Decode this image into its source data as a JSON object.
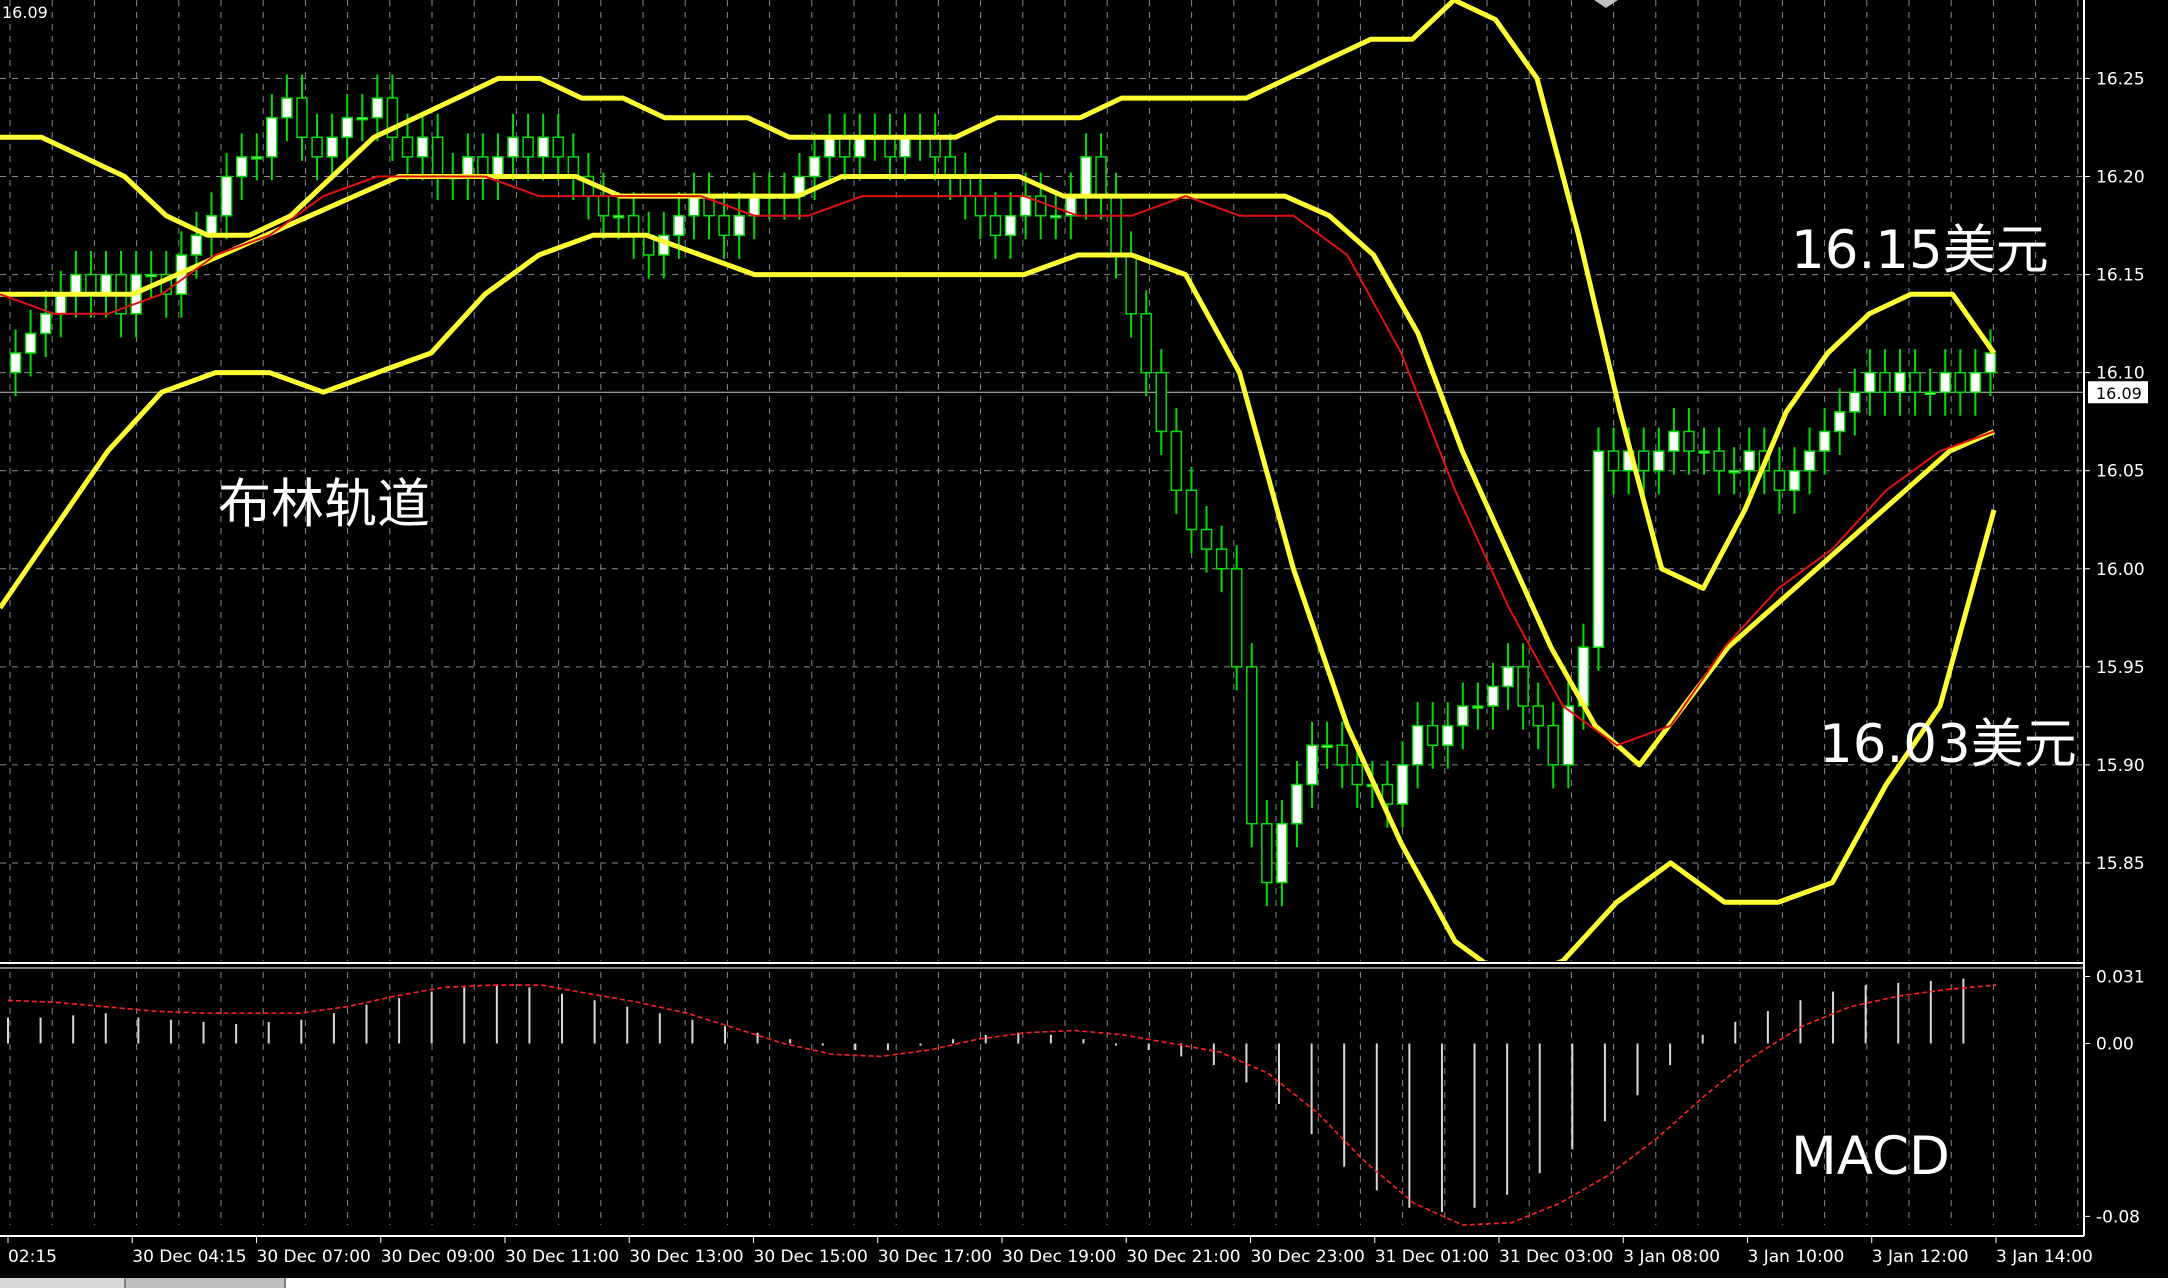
{
  "window": {
    "corner_price": "16.09",
    "colors": {
      "background": "#000000",
      "grid": "#8a8a8a",
      "candle_bull": "#ffffff",
      "candle_bear": "#000000",
      "candle_wick": "#00dd00",
      "bollinger": "#ffff33",
      "ma": "#e01010",
      "macd_hist": "#d8d8d8",
      "macd_signal": "#ff2020",
      "axis_text": "#ffffff"
    }
  },
  "annotations": {
    "bollinger_label": "布林轨道",
    "upper_target": "16.15美元",
    "lower_target": "16.03美元",
    "macd_label": "MACD"
  },
  "chart_data": [
    {
      "type": "candlestick",
      "title": "",
      "ylim": [
        15.8,
        16.29
      ],
      "y_ticks": [
        "16.25",
        "16.20",
        "16.15",
        "16.10",
        "16.05",
        "16.00",
        "15.95",
        "15.90",
        "15.85"
      ],
      "current_price": "16.09",
      "grid": true,
      "x_labels": [
        "02:15",
        "30 Dec 04:15",
        "30 Dec 07:00",
        "30 Dec 09:00",
        "30 Dec 11:00",
        "30 Dec 13:00",
        "30 Dec 15:00",
        "30 Dec 17:00",
        "30 Dec 19:00",
        "30 Dec 21:00",
        "30 Dec 23:00",
        "31 Dec 01:00",
        "31 Dec 03:00",
        "3 Jan 08:00",
        "3 Jan 10:00",
        "3 Jan 12:00",
        "3 Jan 14:00"
      ],
      "close": [
        16.11,
        16.12,
        16.13,
        16.14,
        16.15,
        16.14,
        16.15,
        16.13,
        16.15,
        16.15,
        16.14,
        16.16,
        16.17,
        16.18,
        16.2,
        16.21,
        16.21,
        16.23,
        16.24,
        16.22,
        16.21,
        16.22,
        16.23,
        16.23,
        16.24,
        16.22,
        16.21,
        16.22,
        16.2,
        16.2,
        16.21,
        16.2,
        16.21,
        16.22,
        16.21,
        16.22,
        16.21,
        16.2,
        16.19,
        16.18,
        16.18,
        16.17,
        16.16,
        16.17,
        16.18,
        16.19,
        16.18,
        16.17,
        16.18,
        16.19,
        16.19,
        16.19,
        16.2,
        16.21,
        16.22,
        16.21,
        16.22,
        16.22,
        16.21,
        16.22,
        16.22,
        16.21,
        16.2,
        16.19,
        16.18,
        16.17,
        16.18,
        16.19,
        16.18,
        16.18,
        16.19,
        16.21,
        16.19,
        16.16,
        16.13,
        16.1,
        16.07,
        16.04,
        16.02,
        16.01,
        16.0,
        15.95,
        15.87,
        15.84,
        15.87,
        15.89,
        15.91,
        15.91,
        15.9,
        15.89,
        15.89,
        15.88,
        15.9,
        15.92,
        15.91,
        15.92,
        15.93,
        15.93,
        15.94,
        15.95,
        15.93,
        15.92,
        15.9,
        15.93,
        15.96,
        16.06,
        16.05,
        16.06,
        16.05,
        16.06,
        16.07,
        16.06,
        16.06,
        16.05,
        16.05,
        16.06,
        16.05,
        16.04,
        16.05,
        16.06,
        16.07,
        16.08,
        16.09,
        16.1,
        16.09,
        16.1,
        16.09,
        16.09,
        16.1,
        16.09,
        16.1,
        16.11
      ],
      "series": [
        {
          "name": "",
          "kind": "upper_band",
          "values": [
            16.22,
            16.22,
            16.21,
            16.2,
            16.18,
            16.17,
            16.17,
            16.18,
            16.2,
            16.22,
            16.23,
            16.24,
            16.25,
            16.25,
            16.24,
            16.24,
            16.23,
            16.23,
            16.23,
            16.22,
            16.22,
            16.22,
            16.22,
            16.22,
            16.23,
            16.23,
            16.23,
            16.24,
            16.24,
            16.24,
            16.24,
            16.25,
            16.26,
            16.27,
            16.27,
            16.29,
            16.28,
            16.25,
            16.17,
            16.08,
            16.0,
            15.99,
            16.03,
            16.08,
            16.11,
            16.13,
            16.14,
            16.14,
            16.11
          ]
        },
        {
          "name": "",
          "kind": "middle_band",
          "values": [
            16.14,
            16.14,
            16.14,
            16.14,
            16.15,
            16.16,
            16.17,
            16.18,
            16.19,
            16.2,
            16.2,
            16.2,
            16.2,
            16.2,
            16.19,
            16.19,
            16.19,
            16.19,
            16.19,
            16.2,
            16.2,
            16.2,
            16.2,
            16.2,
            16.19,
            16.19,
            16.19,
            16.19,
            16.19,
            16.19,
            16.18,
            16.16,
            16.12,
            16.06,
            16.01,
            15.96,
            15.92,
            15.9,
            15.93,
            15.96,
            15.98,
            16.0,
            16.02,
            16.04,
            16.06,
            16.07
          ]
        },
        {
          "name": "",
          "kind": "lower_band",
          "values": [
            15.98,
            16.02,
            16.06,
            16.09,
            16.1,
            16.1,
            16.09,
            16.1,
            16.11,
            16.14,
            16.16,
            16.17,
            16.17,
            16.16,
            16.15,
            16.15,
            16.15,
            16.15,
            16.15,
            16.15,
            16.16,
            16.16,
            16.15,
            16.1,
            16.0,
            15.92,
            15.86,
            15.81,
            15.79,
            15.8,
            15.83,
            15.85,
            15.83,
            15.83,
            15.84,
            15.89,
            15.93,
            16.03
          ]
        },
        {
          "name": "",
          "kind": "moving_average",
          "values": [
            16.14,
            16.13,
            16.13,
            16.14,
            16.16,
            16.17,
            16.19,
            16.2,
            16.2,
            16.2,
            16.19,
            16.19,
            16.19,
            16.19,
            16.18,
            16.18,
            16.19,
            16.19,
            16.19,
            16.19,
            16.18,
            16.18,
            16.19,
            16.18,
            16.18,
            16.16,
            16.11,
            16.04,
            15.98,
            15.93,
            15.91,
            15.92,
            15.96,
            15.99,
            16.01,
            16.04,
            16.06,
            16.07
          ]
        }
      ]
    },
    {
      "type": "bar",
      "title": "",
      "ylim": [
        -0.084,
        0.034
      ],
      "y_ticks": [
        "0.031",
        "0.00",
        "-0.08"
      ],
      "series": [
        {
          "name": "",
          "kind": "histogram",
          "values": [
            0.012,
            0.012,
            0.013,
            0.014,
            0.012,
            0.011,
            0.01,
            0.009,
            0.01,
            0.011,
            0.014,
            0.018,
            0.021,
            0.024,
            0.026,
            0.027,
            0.026,
            0.023,
            0.02,
            0.017,
            0.014,
            0.011,
            0.008,
            0.005,
            0.002,
            -0.001,
            -0.003,
            -0.003,
            -0.001,
            0.002,
            0.004,
            0.005,
            0.004,
            0.002,
            -0.001,
            -0.003,
            -0.006,
            -0.01,
            -0.018,
            -0.028,
            -0.042,
            -0.057,
            -0.068,
            -0.076,
            -0.078,
            -0.076,
            -0.07,
            -0.06,
            -0.049,
            -0.036,
            -0.024,
            -0.01,
            0.004,
            0.01,
            0.015,
            0.02,
            0.024,
            0.027,
            0.028,
            0.029,
            0.03
          ]
        },
        {
          "name": "",
          "kind": "signal",
          "values": [
            0.02,
            0.019,
            0.017,
            0.015,
            0.014,
            0.014,
            0.014,
            0.017,
            0.022,
            0.026,
            0.027,
            0.027,
            0.023,
            0.019,
            0.014,
            0.007,
            0.0,
            -0.005,
            -0.006,
            -0.003,
            0.002,
            0.005,
            0.006,
            0.004,
            0.0,
            -0.004,
            -0.014,
            -0.032,
            -0.055,
            -0.074,
            -0.084,
            -0.083,
            -0.074,
            -0.061,
            -0.044,
            -0.024,
            -0.006,
            0.008,
            0.017,
            0.022,
            0.025,
            0.027
          ]
        }
      ]
    }
  ]
}
